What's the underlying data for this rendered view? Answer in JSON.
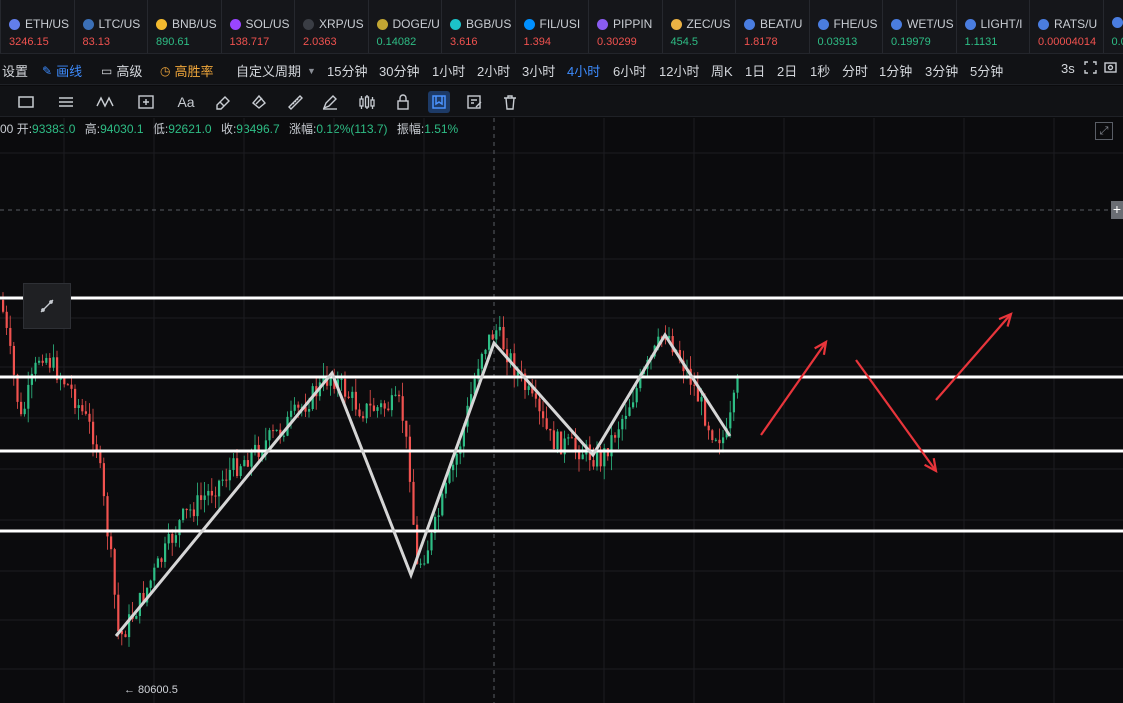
{
  "ticker": [
    {
      "name": "ETH/US",
      "price": "3246.15",
      "dir": "dn",
      "color": "#627eea"
    },
    {
      "name": "LTC/US",
      "price": "83.13",
      "dir": "dn",
      "color": "#3b6fb6"
    },
    {
      "name": "BNB/US",
      "price": "890.61",
      "dir": "up",
      "color": "#f3ba2f"
    },
    {
      "name": "SOL/US",
      "price": "138.717",
      "dir": "dn",
      "color": "#9945ff"
    },
    {
      "name": "XRP/US",
      "price": "2.0363",
      "dir": "dn",
      "color": "#3a3d44"
    },
    {
      "name": "DOGE/U",
      "price": "0.14082",
      "dir": "up",
      "color": "#c2a633"
    },
    {
      "name": "BGB/US",
      "price": "3.616",
      "dir": "dn",
      "color": "#1cc3c9"
    },
    {
      "name": "FIL/USI",
      "price": "1.394",
      "dir": "dn",
      "color": "#0090ff"
    },
    {
      "name": "PIPPIN",
      "price": "0.30299",
      "dir": "dn",
      "color": "#8a5cf0"
    },
    {
      "name": "ZEC/US",
      "price": "454.5",
      "dir": "up",
      "color": "#ecb244"
    },
    {
      "name": "BEAT/U",
      "price": "1.8178",
      "dir": "dn",
      "color": "#4a7de0"
    },
    {
      "name": "FHE/US",
      "price": "0.03913",
      "dir": "up",
      "color": "#4a7de0"
    },
    {
      "name": "WET/US",
      "price": "0.19979",
      "dir": "up",
      "color": "#4a7de0"
    },
    {
      "name": "LIGHT/I",
      "price": "1.1131",
      "dir": "up",
      "color": "#4a7de0"
    },
    {
      "name": "RATS/U",
      "price": "0.00004014",
      "dir": "dn",
      "color": "#4a7de0"
    },
    {
      "name": "",
      "price": "0.0",
      "dir": "up",
      "color": "#4a7de0"
    }
  ],
  "toolbar1": {
    "settings": "设置",
    "draw": "画线",
    "advanced": "高级",
    "winrate": "高胜率",
    "custom_period": "自定义周期",
    "periods": [
      "15分钟",
      "30分钟",
      "1小时",
      "2小时",
      "3小时",
      "4小时",
      "6小时",
      "12小时",
      "周K",
      "1日",
      "2日",
      "1秒",
      "分时",
      "1分钟",
      "3分钟",
      "5分钟"
    ],
    "active_period": "4小时",
    "refresh": "3s"
  },
  "toolbar2": {
    "tools": [
      "rectangle-icon",
      "horizontal-lines-icon",
      "wave-pattern-icon",
      "crosshair-box-icon",
      "text-icon",
      "eraser-icon",
      "layer-icon",
      "ruler-icon",
      "pen-icon",
      "candles-icon",
      "lock-icon",
      "bookmark-icon",
      "edit-note-icon",
      "trash-icon"
    ]
  },
  "info": {
    "prefix": "00",
    "open_label": "开:",
    "open": "93383.0",
    "high_label": "高:",
    "high": "94030.1",
    "low_label": "低:",
    "low": "92621.0",
    "close_label": "收:",
    "close": "93496.7",
    "change_label": "涨幅:",
    "change": "0.12%(113.7)",
    "amp_label": "振幅:",
    "amp": "1.51%"
  },
  "chart": {
    "low_marker": "← 80600.5",
    "colors": {
      "up": "#2ebd85",
      "down": "#f0524f",
      "zigzag": "#d6d6d6",
      "level": "#ffffff",
      "arrow": "#e8353b"
    }
  }
}
